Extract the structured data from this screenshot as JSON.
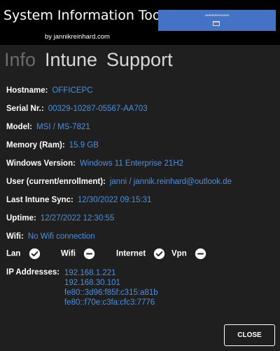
{
  "header": {
    "title": "System Information Tool",
    "subtitle": "by jannikreinhard.com",
    "button_label": "JANNIKREINHARD",
    "button_icon": "window-icon",
    "background": "#000000",
    "button_color": "#4472c4"
  },
  "tabs": [
    {
      "label": "Info",
      "selected": true
    },
    {
      "label": "Intune",
      "selected": false
    },
    {
      "label": "Support",
      "selected": false
    }
  ],
  "info": [
    {
      "label": "Hostname:",
      "value": "OFFICEPC"
    },
    {
      "label": "Serial Nr.:",
      "value": "00329-10287-05567-AA703"
    },
    {
      "label": "Model:",
      "value": "MSI / MS-7821"
    },
    {
      "label": "Memory (Ram):",
      "value": "15.9 GB"
    },
    {
      "label": "Windows Version:",
      "value": "Windows 11 Enterprise 21H2"
    },
    {
      "label": "User (current/enrollment):",
      "value": "janni / jannik.reinhard@outlook.de"
    },
    {
      "label": "Last Intune Sync:",
      "value": "12/30/2022 09:15:31"
    },
    {
      "label": "Uptime:",
      "value": "12/27/2022 12:30:55"
    },
    {
      "label": "Wifi:",
      "value": "No Wifi connection"
    }
  ],
  "status": [
    {
      "label": "Lan",
      "state": "connected",
      "icon": "check-circle-icon"
    },
    {
      "label": "Wifi",
      "state": "disconnected",
      "icon": "minus-circle-icon"
    },
    {
      "label": "Internet",
      "state": "connected",
      "icon": "check-circle-icon"
    },
    {
      "label": "Vpn",
      "state": "disconnected",
      "icon": "minus-circle-icon"
    }
  ],
  "ip": {
    "label": "IP Addresses:",
    "addresses": [
      "192.168.1.221",
      "192.168.30.101",
      "fe80::3d96:f85f:c315:a81b",
      "fe80::f70e:c3fa:cfc3:7776"
    ]
  },
  "close_label": "CLOSE",
  "colors": {
    "value_text": "#4a90e2",
    "background": "#1f1f1f",
    "tab_selected": "#6b6b6b",
    "tab_unselected": "#d8d8d8"
  }
}
